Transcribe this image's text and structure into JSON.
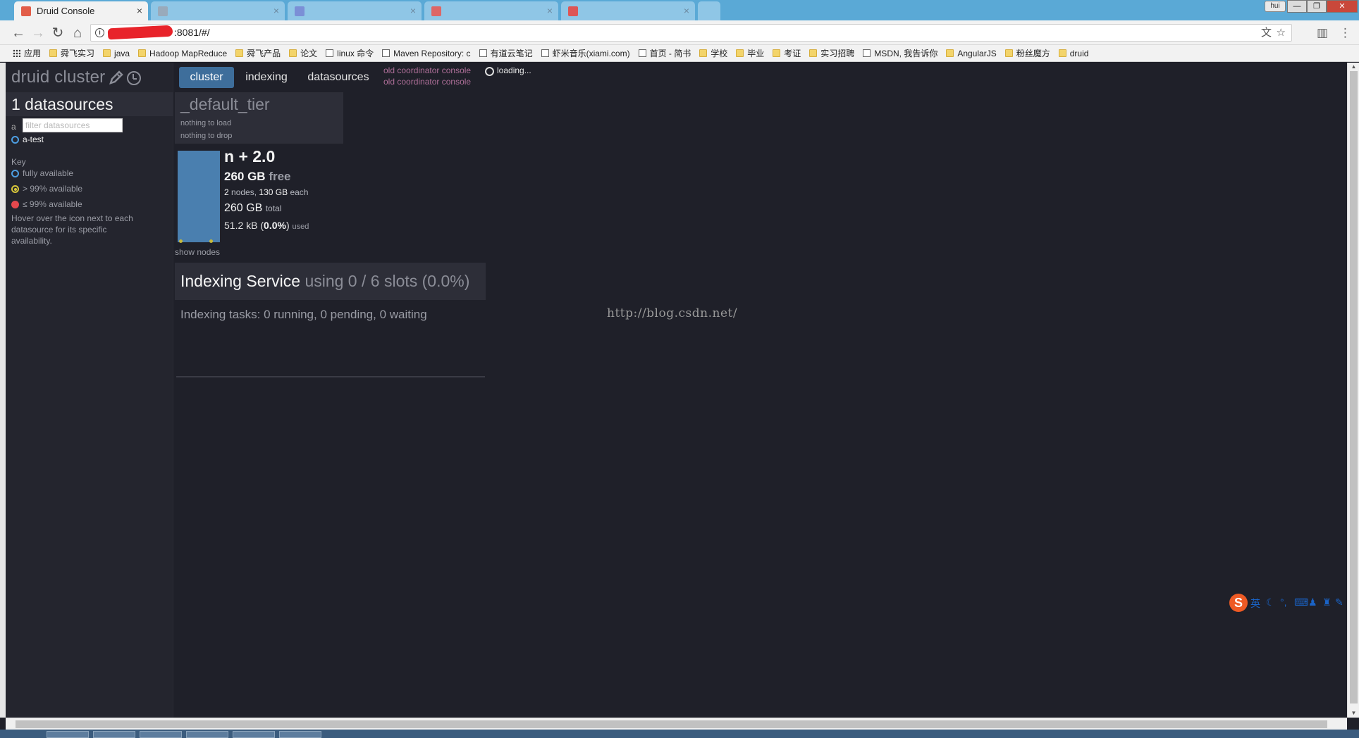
{
  "browser": {
    "active_tab": {
      "title": "Druid Console",
      "close": "×"
    },
    "inactive_tabs": [
      {
        "title": "",
        "close": "×"
      },
      {
        "title": "",
        "close": "×"
      },
      {
        "title": "",
        "close": "×"
      },
      {
        "title": "",
        "close": "×"
      }
    ],
    "user_badge": "hui",
    "window_controls": {
      "minimize": "—",
      "restore": "❐",
      "close": "✕"
    },
    "url": ":8081/#/",
    "bookmarks": [
      {
        "label": "应用",
        "icon": "apps-icon"
      },
      {
        "label": "舜飞实习",
        "icon": "folder-icon"
      },
      {
        "label": "java",
        "icon": "folder-icon"
      },
      {
        "label": "Hadoop MapReduce",
        "icon": "folder-icon"
      },
      {
        "label": "舜飞产品",
        "icon": "folder-icon"
      },
      {
        "label": "论文",
        "icon": "folder-icon"
      },
      {
        "label": "linux 命令",
        "icon": "page-icon"
      },
      {
        "label": "Maven Repository: c",
        "icon": "page-icon"
      },
      {
        "label": "有道云笔记",
        "icon": "page-icon"
      },
      {
        "label": "虾米音乐(xiami.com)",
        "icon": "page-icon"
      },
      {
        "label": "首页 - 简书",
        "icon": "page-icon"
      },
      {
        "label": "学校",
        "icon": "folder-icon"
      },
      {
        "label": "毕业",
        "icon": "folder-icon"
      },
      {
        "label": "考证",
        "icon": "folder-icon"
      },
      {
        "label": "实习招聘",
        "icon": "folder-icon"
      },
      {
        "label": "MSDN, 我告诉你",
        "icon": "page-icon"
      },
      {
        "label": "AngularJS",
        "icon": "folder-icon"
      },
      {
        "label": "粉丝魔方",
        "icon": "folder-icon"
      },
      {
        "label": "druid",
        "icon": "folder-icon"
      }
    ]
  },
  "sidebar": {
    "cluster_title": "druid cluster",
    "datasource_count": "1 datasources",
    "filter_letter": "a",
    "filter_placeholder": "filter datasources",
    "datasources": [
      {
        "name": "a-test"
      }
    ],
    "key_title": "Key",
    "key_items": [
      {
        "label": "fully available",
        "color": "#4d9ee2"
      },
      {
        "label": "> 99% available",
        "color": "#d8c73b"
      },
      {
        "label": "≤ 99% available",
        "color": "#e5484d"
      }
    ],
    "key_help": "Hover over the icon next to each datasource for its specific availability."
  },
  "nav": {
    "tabs": [
      {
        "label": "cluster",
        "active": true
      },
      {
        "label": "indexing",
        "active": false
      },
      {
        "label": "datasources",
        "active": false
      }
    ],
    "old_coordinator_links": [
      "old coordinator console",
      "old coordinator console"
    ],
    "loading": "loading..."
  },
  "tier": {
    "name": "_default_tier",
    "load_status": "nothing to load",
    "drop_status": "nothing to drop",
    "replication": "n + 2.0",
    "free_amount": "260 GB",
    "free_label": "free",
    "node_count": "2",
    "nodes_label": "nodes,",
    "per_node": "130 GB",
    "each_label": "each",
    "total_amount": "260 GB",
    "total_label": "total",
    "used_amount": "51.2 kB",
    "used_percent": "0.0%",
    "used_label": "used",
    "used_fraction": 0.0,
    "show_nodes": "show nodes"
  },
  "indexing": {
    "title": "Indexing Service",
    "slots": "using 0 / 6 slots (0.0%)",
    "tasks": "Indexing tasks: 0 running, 0 pending, 0 waiting"
  },
  "watermark": "http://blog.csdn.net/",
  "ime": {
    "mode": "英"
  },
  "colors": {
    "accent": "#3e6e9b",
    "background": "#1f2029",
    "panel": "#2d2e38",
    "bar": "#4a7faf"
  }
}
